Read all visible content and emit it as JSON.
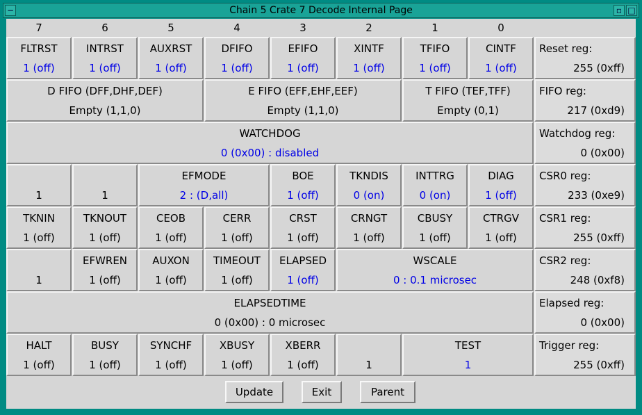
{
  "window": {
    "title": "Chain 5 Crate 7 Decode Internal Page",
    "menu_glyph": "−",
    "iconify_glyph": "▫",
    "maximize_glyph": "□"
  },
  "bits": [
    "7",
    "6",
    "5",
    "4",
    "3",
    "2",
    "1",
    "0"
  ],
  "rows": {
    "reset": [
      {
        "label": "FLTRST",
        "value": "1 (off)",
        "blue": true
      },
      {
        "label": "INTRST",
        "value": "1 (off)",
        "blue": true
      },
      {
        "label": "AUXRST",
        "value": "1 (off)",
        "blue": true
      },
      {
        "label": "DFIFO",
        "value": "1 (off)",
        "blue": true
      },
      {
        "label": "EFIFO",
        "value": "1 (off)",
        "blue": true
      },
      {
        "label": "XINTF",
        "value": "1 (off)",
        "blue": true
      },
      {
        "label": "TFIFO",
        "value": "1 (off)",
        "blue": true
      },
      {
        "label": "CINTF",
        "value": "1 (off)",
        "blue": true
      }
    ],
    "fifo": [
      {
        "label": "D FIFO (DFF,DHF,DEF)",
        "value": "Empty (1,1,0)"
      },
      {
        "label": "E FIFO (EFF,EHF,EEF)",
        "value": "Empty (1,1,0)"
      },
      {
        "label": "T FIFO (TEF,TFF)",
        "value": "Empty (0,1)"
      }
    ],
    "watchdog": {
      "label": "WATCHDOG",
      "value": "0 (0x00) : disabled"
    },
    "csr0": [
      {
        "label": "",
        "value": "1"
      },
      {
        "label": "",
        "value": "1"
      },
      {
        "label": "EFMODE",
        "value": "2 : (D,all)",
        "blue": true
      },
      {
        "label": "BOE",
        "value": "1 (off)",
        "blue": true
      },
      {
        "label": "TKNDIS",
        "value": "0 (on)",
        "blue": true
      },
      {
        "label": "INTTRG",
        "value": "0 (on)",
        "blue": true
      },
      {
        "label": "DIAG",
        "value": "1 (off)",
        "blue": true
      }
    ],
    "csr1": [
      {
        "label": "TKNIN",
        "value": "1 (off)"
      },
      {
        "label": "TKNOUT",
        "value": "1 (off)"
      },
      {
        "label": "CEOB",
        "value": "1 (off)"
      },
      {
        "label": "CERR",
        "value": "1 (off)"
      },
      {
        "label": "CRST",
        "value": "1 (off)"
      },
      {
        "label": "CRNGT",
        "value": "1 (off)"
      },
      {
        "label": "CBUSY",
        "value": "1 (off)"
      },
      {
        "label": "CTRGV",
        "value": "1 (off)"
      }
    ],
    "csr2": [
      {
        "label": "",
        "value": "1"
      },
      {
        "label": "EFWREN",
        "value": "1 (off)"
      },
      {
        "label": "AUXON",
        "value": "1 (off)"
      },
      {
        "label": "TIMEOUT",
        "value": "1 (off)"
      },
      {
        "label": "ELAPSED",
        "value": "1 (off)",
        "blue": true
      },
      {
        "label": "WSCALE",
        "value": "0 : 0.1 microsec",
        "blue": true
      }
    ],
    "elapsed": {
      "label": "ELAPSEDTIME",
      "value": "0 (0x00) : 0 microsec"
    },
    "trigger": [
      {
        "label": "HALT",
        "value": "1 (off)"
      },
      {
        "label": "BUSY",
        "value": "1 (off)"
      },
      {
        "label": "SYNCHF",
        "value": "1 (off)"
      },
      {
        "label": "XBUSY",
        "value": "1 (off)"
      },
      {
        "label": "XBERR",
        "value": "1 (off)"
      },
      {
        "label": "",
        "value": "1"
      },
      {
        "label": "TEST",
        "value": "1",
        "blue": true
      }
    ]
  },
  "registers": [
    {
      "label": "Reset reg:",
      "value": "255 (0xff)"
    },
    {
      "label": "FIFO reg:",
      "value": "217 (0xd9)"
    },
    {
      "label": "Watchdog reg:",
      "value": "0 (0x00)"
    },
    {
      "label": "CSR0 reg:",
      "value": "233 (0xe9)"
    },
    {
      "label": "CSR1 reg:",
      "value": "255 (0xff)"
    },
    {
      "label": "CSR2 reg:",
      "value": "248 (0xf8)"
    },
    {
      "label": "Elapsed reg:",
      "value": "0 (0x00)"
    },
    {
      "label": "Trigger reg:",
      "value": "255 (0xff)"
    }
  ],
  "buttons": {
    "update": "Update",
    "exit": "Exit",
    "parent": "Parent"
  },
  "colors": {
    "accent_blue": "#0000e6",
    "title_bar": "#19a397",
    "frame": "#008b83"
  }
}
